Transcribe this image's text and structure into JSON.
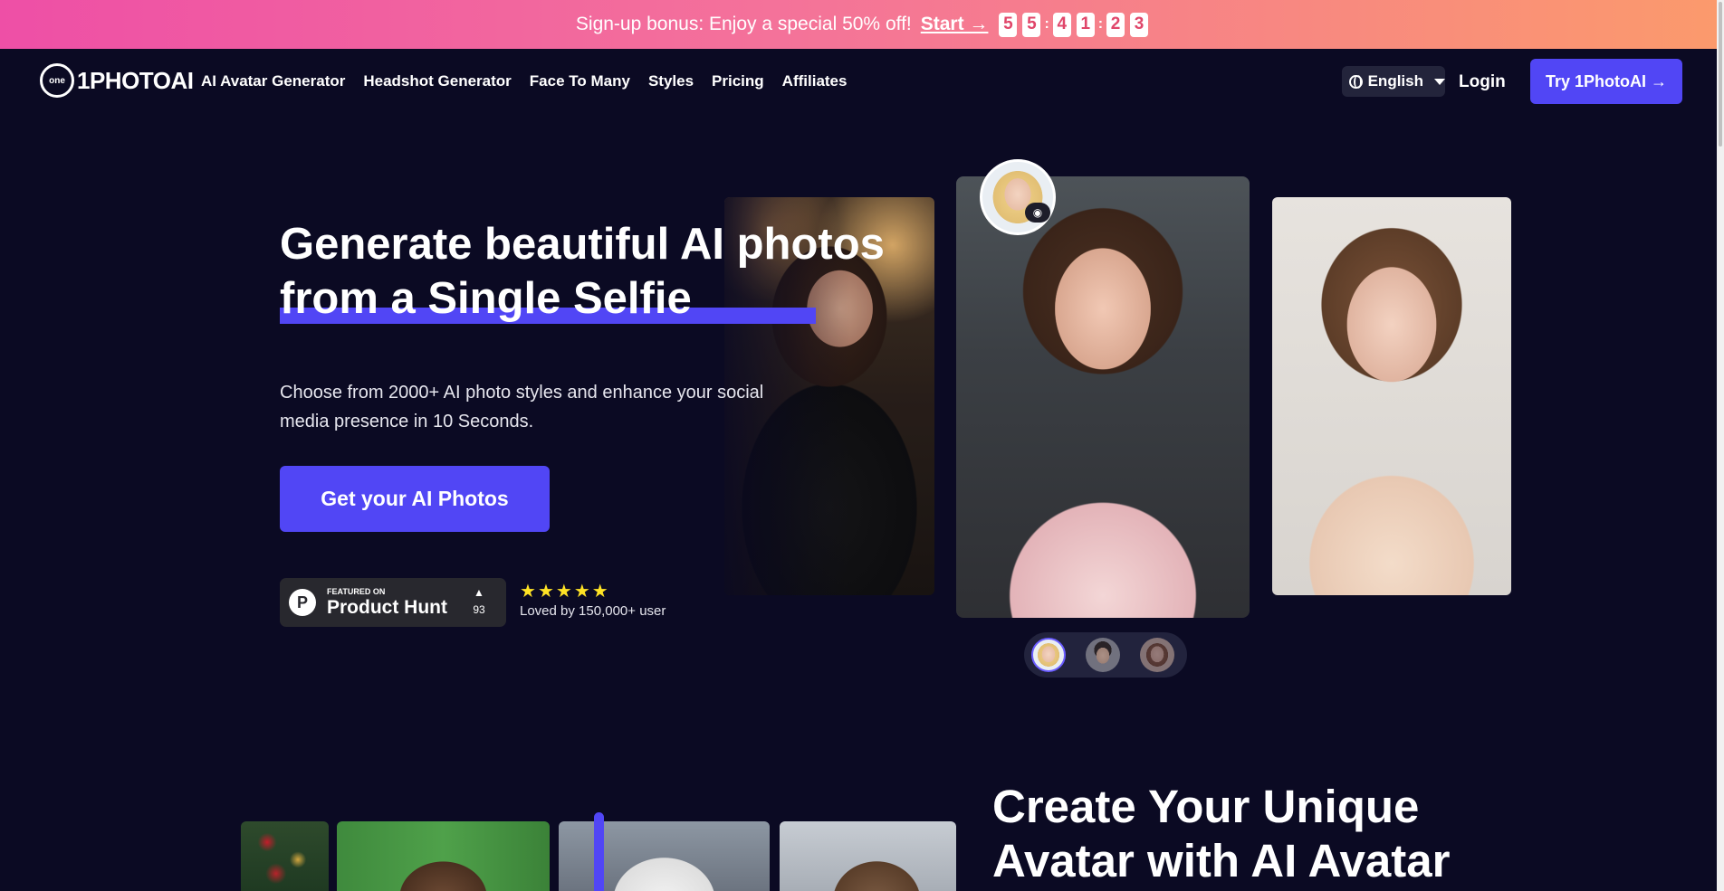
{
  "promo": {
    "text": "Sign-up bonus: Enjoy a special 50% off!",
    "start_label": "Start →",
    "countdown": [
      "5",
      "5",
      "4",
      "1",
      "2",
      "3"
    ]
  },
  "nav": {
    "logo_mark": "one",
    "logo_text": "1PHOTOAI",
    "links": [
      "AI Avatar Generator",
      "Headshot Generator",
      "Face To Many",
      "Styles",
      "Pricing",
      "Affiliates"
    ],
    "language": "English",
    "login": "Login",
    "try_button": "Try 1PhotoAI →"
  },
  "hero": {
    "title_line1": "Generate beautiful AI photos",
    "title_line2": "from a Single Selfie",
    "subtitle": "Choose from 2000+ AI photo styles and enhance your social media presence in 10 Seconds.",
    "cta": "Get your AI Photos",
    "product_hunt": {
      "featured": "FEATURED ON",
      "name": "Product Hunt",
      "arrow": "▲",
      "count": "93",
      "logo": "P"
    },
    "rating_stars": 5,
    "loved_text": "Loved by 150,000+ user"
  },
  "section2": {
    "title": "Create Your Unique Avatar with AI Avatar"
  },
  "colors": {
    "background": "#0b0a23",
    "accent": "#5146f5",
    "star": "#ffe325"
  },
  "icons": [
    "globe-icon",
    "caret-down-icon",
    "camera-icon",
    "star-icon",
    "product-hunt-logo"
  ]
}
